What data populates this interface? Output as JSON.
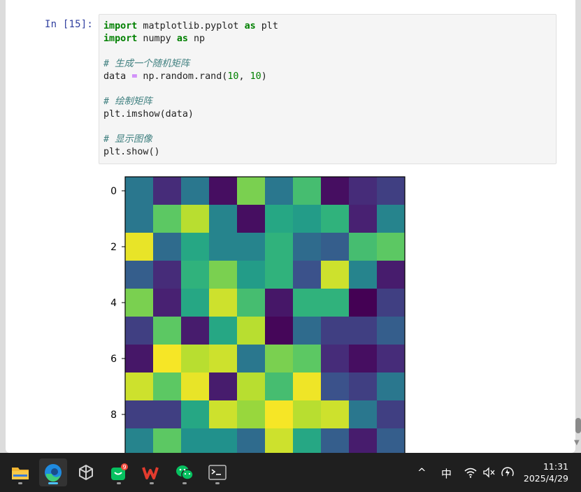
{
  "notebook": {
    "cell_prompt": "In  [15]:",
    "code_lines": [
      {
        "type": "import",
        "kw1": "import",
        "module": " matplotlib.pyplot ",
        "kw2": "as",
        "alias": " plt"
      },
      {
        "type": "import",
        "kw1": "import",
        "module": " numpy ",
        "kw2": "as",
        "alias": " np"
      },
      {
        "type": "blank"
      },
      {
        "type": "comment",
        "text": "# 生成一个随机矩阵"
      },
      {
        "type": "assign",
        "lhs": "data ",
        "op": "=",
        "rhs_fn": " np.random.rand(",
        "arg1": "10",
        "sep": ", ",
        "arg2": "10",
        "close": ")"
      },
      {
        "type": "blank"
      },
      {
        "type": "comment",
        "text": "# 绘制矩阵"
      },
      {
        "type": "plain",
        "text": "plt.imshow(data)"
      },
      {
        "type": "blank"
      },
      {
        "type": "comment",
        "text": "# 显示图像"
      },
      {
        "type": "plain",
        "text": "plt.show()"
      }
    ]
  },
  "chart_data": {
    "type": "heatmap",
    "colormap": "viridis",
    "ytick_labels": [
      "0",
      "2",
      "4",
      "6",
      "8"
    ],
    "values": [
      [
        0.4,
        0.15,
        0.4,
        0.05,
        0.8,
        0.4,
        0.7,
        0.05,
        0.15,
        0.2
      ],
      [
        0.4,
        0.75,
        0.9,
        0.45,
        0.05,
        0.6,
        0.55,
        0.65,
        0.12,
        0.45
      ],
      [
        0.97,
        0.35,
        0.6,
        0.45,
        0.45,
        0.65,
        0.35,
        0.3,
        0.7,
        0.75
      ],
      [
        0.3,
        0.15,
        0.65,
        0.8,
        0.55,
        0.65,
        0.25,
        0.93,
        0.45,
        0.1
      ],
      [
        0.8,
        0.12,
        0.6,
        0.93,
        0.7,
        0.08,
        0.65,
        0.65,
        0.0,
        0.2
      ],
      [
        0.2,
        0.75,
        0.1,
        0.6,
        0.9,
        0.02,
        0.35,
        0.2,
        0.2,
        0.3
      ],
      [
        0.08,
        0.99,
        0.9,
        0.93,
        0.4,
        0.8,
        0.75,
        0.15,
        0.05,
        0.15
      ],
      [
        0.93,
        0.75,
        0.97,
        0.1,
        0.9,
        0.7,
        0.98,
        0.25,
        0.2,
        0.4
      ],
      [
        0.2,
        0.2,
        0.6,
        0.93,
        0.85,
        0.99,
        0.9,
        0.93,
        0.4,
        0.2
      ],
      [
        0.45,
        0.75,
        0.5,
        0.5,
        0.35,
        0.93,
        0.6,
        0.3,
        0.1,
        0.3
      ]
    ]
  },
  "taskbar": {
    "apps": [
      {
        "name": "file-explorer",
        "icon": "folder-icon",
        "active": false
      },
      {
        "name": "edge",
        "icon": "edge-icon",
        "active": true
      },
      {
        "name": "unity",
        "icon": "unity-icon",
        "active": false
      },
      {
        "name": "wechat-store",
        "icon": "bag-icon",
        "active": false,
        "badge": "9"
      },
      {
        "name": "wps",
        "icon": "wps-icon",
        "active": false
      },
      {
        "name": "wechat",
        "icon": "wechat-icon",
        "active": false
      },
      {
        "name": "terminal",
        "icon": "terminal-icon",
        "active": false
      }
    ],
    "tray": {
      "chevron": "^",
      "ime": "中",
      "wifi_icon": "wifi-icon",
      "volume_icon": "volume-muted-icon",
      "battery_icon": "battery-charging-icon"
    },
    "clock_time": "11:31",
    "clock_date": "2025/4/29"
  }
}
